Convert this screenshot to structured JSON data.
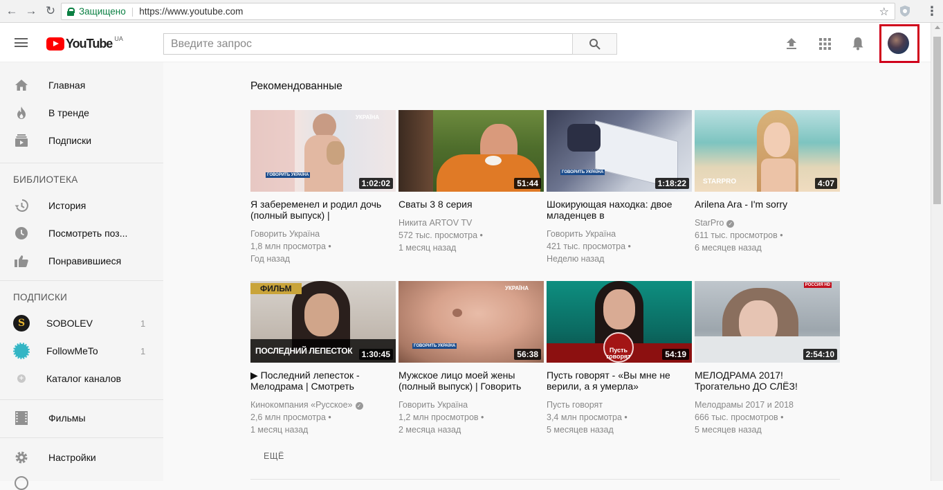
{
  "browser": {
    "secure_label": "Защищено",
    "url": "https://www.youtube.com"
  },
  "header": {
    "logo_text": "YouTube",
    "logo_region": "UA",
    "search_placeholder": "Введите запрос"
  },
  "sidebar": {
    "main": [
      {
        "label": "Главная",
        "icon": "home-icon"
      },
      {
        "label": "В тренде",
        "icon": "flame-icon"
      },
      {
        "label": "Подписки",
        "icon": "subscriptions-icon"
      }
    ],
    "library_header": "БИБЛИОТЕКА",
    "library": [
      {
        "label": "История",
        "icon": "history-icon"
      },
      {
        "label": "Посмотреть поз...",
        "icon": "clock-icon"
      },
      {
        "label": "Понравившиеся",
        "icon": "thumb-up-icon"
      }
    ],
    "subs_header": "ПОДПИСКИ",
    "subs": [
      {
        "label": "SOBOLEV",
        "count": "1"
      },
      {
        "label": "FollowMeTo",
        "count": "1"
      },
      {
        "label": "Каталог каналов",
        "count": ""
      }
    ],
    "films": "Фильмы",
    "settings": "Настройки"
  },
  "main": {
    "section_title": "Рекомендованные",
    "more_label": "ЕЩЁ",
    "videos": [
      {
        "title": "Я забеременел и родил дочь (полный выпуск) |",
        "channel": "Говорить Україна",
        "verified": false,
        "views": "1,8 млн просмотра •",
        "age": "Год назад",
        "duration": "1:02:02"
      },
      {
        "title": "Сваты 3 8 серия",
        "channel": "Никита ARTOV TV",
        "verified": false,
        "views": "572 тыс. просмотра •",
        "age": "1 месяц назад",
        "duration": "51:44"
      },
      {
        "title": "Шокирующая находка: двое младенцев в",
        "channel": "Говорить Україна",
        "verified": false,
        "views": "421 тыс. просмотра •",
        "age": "Неделю назад",
        "duration": "1:18:22"
      },
      {
        "title": "Arilena Ara - I'm sorry",
        "channel": "StarPro",
        "verified": true,
        "views": "611 тыс. просмотров •",
        "age": "6 месяцев назад",
        "duration": "4:07"
      },
      {
        "title": "▶ Последний лепесток - Мелодрама | Смотреть",
        "channel": "Кинокомпания «Русское»",
        "verified": true,
        "views": "2,6 млн просмотра •",
        "age": "1 месяц назад",
        "duration": "1:30:45"
      },
      {
        "title": "Мужское лицо моей жены (полный выпуск) | Говорить",
        "channel": "Говорить Україна",
        "verified": false,
        "views": "1,2 млн просмотров •",
        "age": "2 месяца назад",
        "duration": "56:38"
      },
      {
        "title": "Пусть говорят - «Вы мне не верили, а я умерла»",
        "channel": "Пусть говорят",
        "verified": false,
        "views": "3,4 млн просмотра •",
        "age": "5 месяцев назад",
        "duration": "54:19"
      },
      {
        "title": "МЕЛОДРАМА 2017! Трогательно ДО СЛЁЗ!",
        "channel": "Мелодрамы 2017 и 2018",
        "verified": false,
        "views": "666 тыс. просмотров •",
        "age": "5 месяцев назад",
        "duration": "2:54:10"
      }
    ],
    "thumb_texts": {
      "ukraina": "УКРАЇНА",
      "govoryt": "ГОВОРИТЬ УКРАЇНА",
      "starpro": "STARPRO",
      "film": "ФИЛЬМ",
      "petal": "ПОСЛЕДНИЙ ЛЕПЕСТОК",
      "pust": "Пусть говорят",
      "russia": "РОССИЯ HD"
    }
  }
}
